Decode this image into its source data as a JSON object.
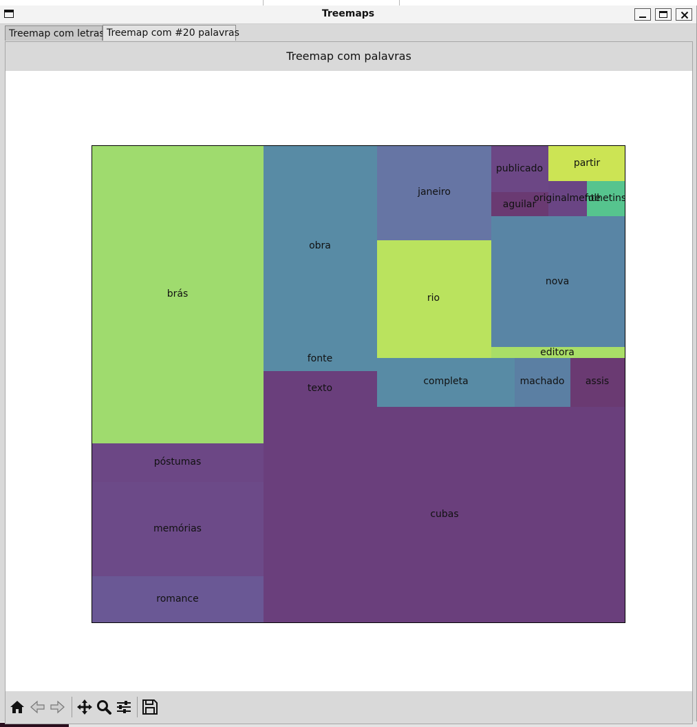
{
  "window": {
    "title": "Treemaps"
  },
  "tabs": [
    {
      "label": "Treemap com letras",
      "active": false
    },
    {
      "label": "Treemap com #20 palavras",
      "active": true
    }
  ],
  "figure": {
    "title": "Treemap com palavras"
  },
  "chart_data": {
    "type": "treemap",
    "title": "Treemap com palavras",
    "axes_visible": false,
    "items": [
      {
        "label": "brás",
        "color": "#9fdb6e"
      },
      {
        "label": "póstumas",
        "color": "#6c4785"
      },
      {
        "label": "memórias",
        "color": "#6c4a88"
      },
      {
        "label": "romance",
        "color": "#6a5895"
      },
      {
        "label": "obra",
        "color": "#588ba5"
      },
      {
        "label": "fonte",
        "color": "#588ba5"
      },
      {
        "label": "texto",
        "color": "#6a3f7c"
      },
      {
        "label": "cubas",
        "color": "#6a3f7c"
      },
      {
        "label": "janeiro",
        "color": "#6675a4"
      },
      {
        "label": "rio",
        "color": "#bae35e"
      },
      {
        "label": "publicado",
        "color": "#6c4785"
      },
      {
        "label": "partir",
        "color": "#cce454"
      },
      {
        "label": "aguilar",
        "color": "#6a3a72"
      },
      {
        "label": "originalmente",
        "color": "#6a4584"
      },
      {
        "label": "folhetins",
        "color": "#56c48e"
      },
      {
        "label": "nova",
        "color": "#5985a5"
      },
      {
        "label": "editora",
        "color": "#a9de67"
      },
      {
        "label": "completa",
        "color": "#588ba5"
      },
      {
        "label": "machado",
        "color": "#5b7fa3"
      },
      {
        "label": "assis",
        "color": "#6a3a72"
      }
    ]
  },
  "toolbar": {
    "buttons": [
      {
        "name": "home-icon"
      },
      {
        "name": "back-arrow-icon"
      },
      {
        "name": "forward-arrow-icon"
      },
      {
        "name": "pan-icon"
      },
      {
        "name": "zoom-icon"
      },
      {
        "name": "configure-subplots-icon"
      },
      {
        "name": "save-icon"
      }
    ]
  }
}
